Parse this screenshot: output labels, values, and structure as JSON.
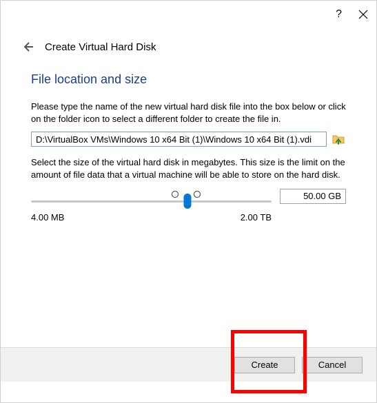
{
  "titlebar": {
    "help_symbol": "?",
    "close_label": "Close"
  },
  "header": {
    "wizard_title": "Create Virtual Hard Disk"
  },
  "section": {
    "heading": "File location and size"
  },
  "location": {
    "desc": "Please type the name of the new virtual hard disk file into the box below or click on the folder icon to select a different folder to create the file in.",
    "path_value": "D:\\VirtualBox VMs\\Windows 10 x64 Bit (1)\\Windows 10 x64 Bit (1).vdi"
  },
  "size": {
    "desc": "Select the size of the virtual hard disk in megabytes. This size is the limit on the amount of file data that a virtual machine will be able to store on the hard disk.",
    "value_display": "50.00 GB",
    "min_label": "4.00 MB",
    "max_label": "2.00 TB"
  },
  "buttons": {
    "create": "Create",
    "cancel": "Cancel"
  }
}
